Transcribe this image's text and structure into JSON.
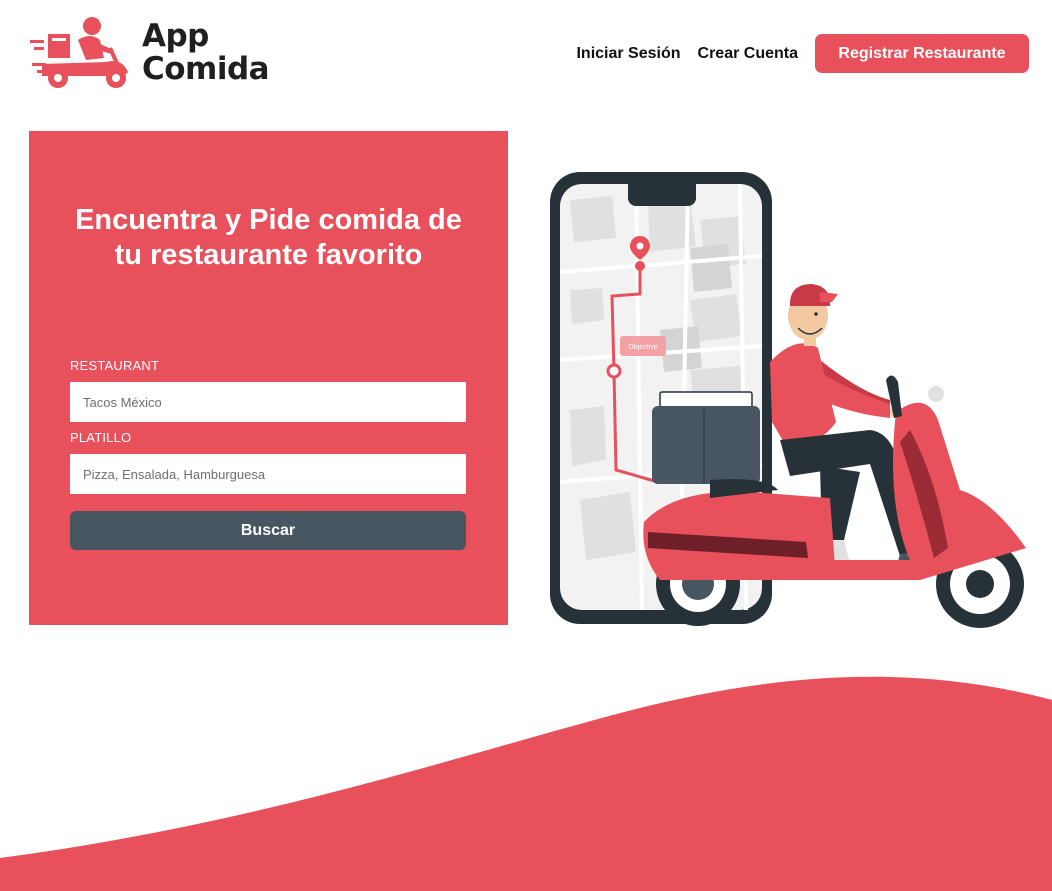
{
  "header": {
    "logo": {
      "line1": "App",
      "line2": "Comida"
    },
    "nav": {
      "login_label": "Iniciar Sesión",
      "signup_label": "Crear Cuenta",
      "register_label": "Registrar Restaurante"
    }
  },
  "hero": {
    "title": "Encuentra y Pide comida de tu restaurante favorito",
    "form": {
      "restaurant_label": "RESTAURANT",
      "restaurant_placeholder": "Tacos México",
      "dish_label": "PLATILLO",
      "dish_placeholder": "Pizza, Ensalada, Hamburguesa",
      "search_label": "Buscar"
    }
  },
  "illustration": {
    "map_tag": "Objective"
  },
  "colors": {
    "accent": "#e8505b",
    "dark": "#475661",
    "ink": "#263238"
  }
}
